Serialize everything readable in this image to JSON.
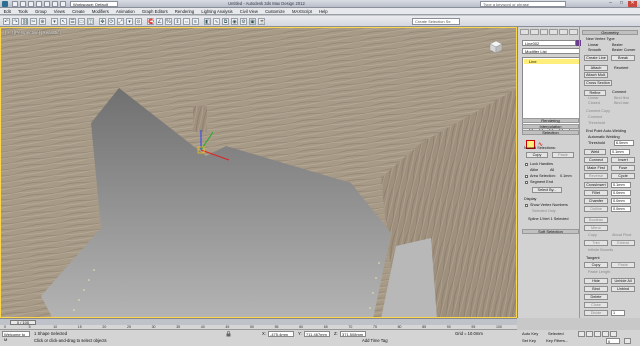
{
  "window": {
    "title": "Untitled - Autodesk 3ds Max Design 2012",
    "workspace": "Workspace: Default",
    "help_search": "Type a keyword or phrase",
    "minimize": "–",
    "maximize": "□",
    "close": "✕"
  },
  "menu": [
    "Edit",
    "Tools",
    "Group",
    "Views",
    "Create",
    "Modifiers",
    "Animation",
    "Graph Editors",
    "Rendering",
    "Lighting Analysis",
    "Civil View",
    "Customize",
    "MAXScript",
    "Help"
  ],
  "toolbar": {
    "selection_set": "Create Selection Se",
    "icons": [
      "undo-icon",
      "redo-icon",
      "link-icon",
      "unlink-icon",
      "bind-icon",
      "select-filter-icon",
      "select-icon",
      "select-by-name-icon",
      "region-icon",
      "window-crossing-icon",
      "move-icon",
      "rotate-icon",
      "scale-icon",
      "reference-coord-icon",
      "pivot-icon",
      "snap-icon",
      "angle-snap-icon",
      "percent-snap-icon",
      "spinner-snap-icon",
      "mirror-icon",
      "align-icon",
      "layer-icon",
      "curve-editor-icon",
      "schematic-icon",
      "material-editor-icon",
      "render-setup-icon",
      "rendered-frame-icon",
      "render-icon"
    ]
  },
  "viewport": {
    "label": "[ + ] [Perspective] [Realistic]"
  },
  "command_panel": {
    "object_name": "Line002",
    "modifier_list": "Modifier List",
    "stack_item": "Line",
    "rollouts": {
      "rendering": "Rendering",
      "interpolation": "Interpolation",
      "selection": "Selection",
      "soft_selection": "Soft Selection",
      "geometry": "Geometry"
    },
    "selection": {
      "named_selections": "Named Selections:",
      "copy": "Copy",
      "paste": "Paste",
      "lock_handles": "Lock Handles",
      "alike": "Alike",
      "all": "All",
      "area_selection": "Area Selection:",
      "area_value": "0.1mm",
      "segment_end": "Segment End",
      "select_by": "Select By...",
      "display": "Display",
      "show_vertex_numbers": "Show Vertex Numbers",
      "selected_only": "Selected Only",
      "status": "Spline 1/Vert 1 Selected"
    },
    "geometry": {
      "new_vertex_type": "New Vertex Type",
      "linear": "Linear",
      "bezier": "Bezier",
      "smooth": "Smooth",
      "bezier_corner": "Bezier Corner",
      "create_line": "Create Line",
      "break": "Break",
      "attach": "Attach",
      "reorient": "Reorient",
      "attach_mult": "Attach Mult.",
      "cross_section": "Cross Section",
      "refine": "Refine",
      "connect": "Connect",
      "linear_chk": "Linear",
      "bind_first": "Bind first",
      "closed": "Closed",
      "bind_last": "Bind last",
      "connect_copy": "Connect Copy",
      "connect_chk": "Connect",
      "threshold": "Threshold",
      "end_point_auto_welding": "End Point Auto-Welding",
      "automatic_welding": "Automatic Welding",
      "threshold_value": "6.0mm",
      "weld": "Weld",
      "weld_value": "0.1mm",
      "connect_btn": "Connect",
      "insert": "Insert",
      "make_first": "Make First",
      "fuse": "Fuse",
      "reverse": "Reverse",
      "cycle": "Cycle",
      "crossinsert": "CrossInsert",
      "crossinsert_value": "0.1mm",
      "fillet": "Fillet",
      "fillet_value": "0.0mm",
      "chamfer": "Chamfer",
      "chamfer_value": "0.0mm",
      "outline": "Outline",
      "outline_value": "0.0mm",
      "boolean": "Boolean",
      "mirror": "Mirror",
      "copy_chk": "Copy",
      "about_pivot": "About Pivot",
      "trim": "Trim",
      "extend": "Extend",
      "infinite_bounds": "Infinite Bounds",
      "tangent": "Tangent",
      "tangent_copy": "Copy",
      "tangent_paste": "Paste",
      "paste_length": "Paste Length",
      "hide": "Hide",
      "unhide_all": "Unhide All",
      "bind": "Bind",
      "unbind": "Unbind",
      "delete": "Delete",
      "close": "Close",
      "divide": "Divide",
      "divide_value": "1"
    }
  },
  "timeline": {
    "frame": "0 / 100",
    "ticks": [
      "0",
      "5",
      "10",
      "15",
      "20",
      "25",
      "30",
      "35",
      "40",
      "45",
      "50",
      "55",
      "60",
      "65",
      "70",
      "75",
      "80",
      "85",
      "90",
      "95",
      "100"
    ]
  },
  "status": {
    "maxscript": "Welcome to M",
    "selection": "1 Shape Selected",
    "prompt": "Click or click-and-drag to select objects",
    "x_label": "X:",
    "x_value": "-475.4mm",
    "y_label": "Y:",
    "y_value": "711.467mm",
    "z_label": "Z:",
    "z_value": "371.508mm",
    "grid": "Grid = 10.0mm",
    "add_time_tag": "Add Time Tag",
    "auto_key": "Auto Key",
    "selected": "Selected",
    "set_key": "Set Key",
    "key_filters": "Key Filters...",
    "frame_value": "0"
  },
  "colors": {
    "viewport_border": "#ffd54a",
    "object_color": "#6a3c8c",
    "stack_highlight": "#ffef7a"
  }
}
